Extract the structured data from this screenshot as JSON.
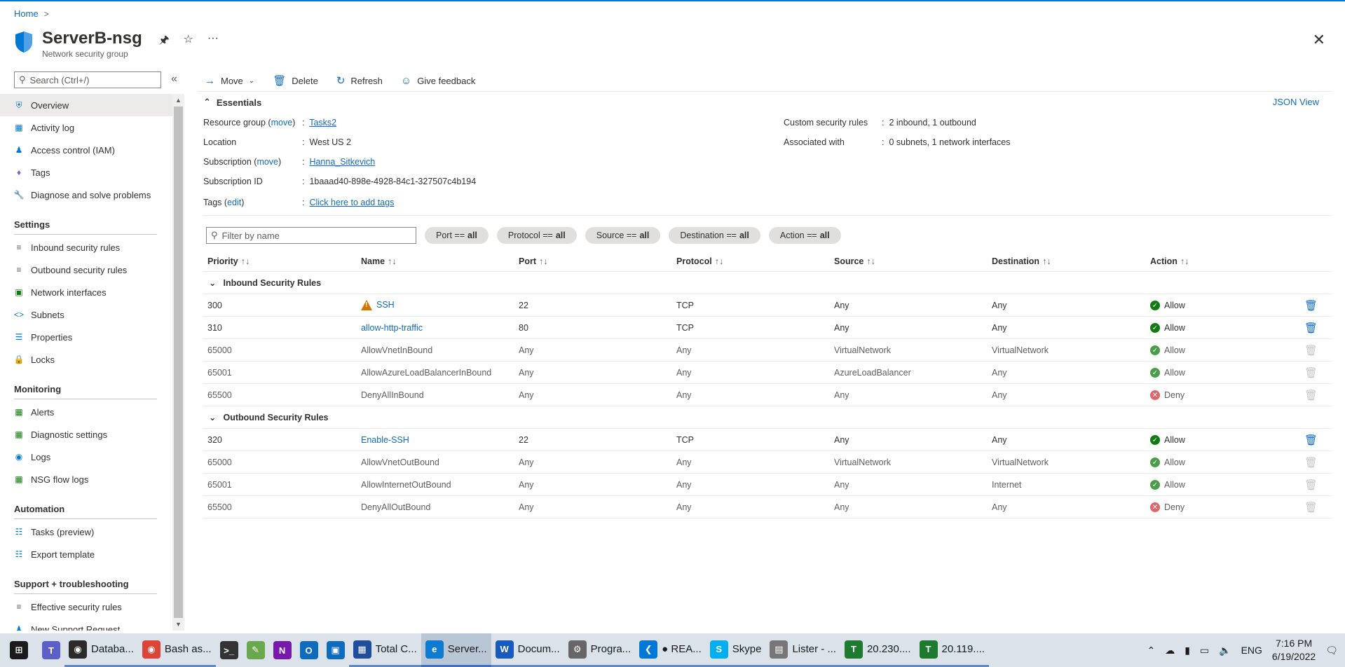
{
  "breadcrumb": {
    "home": "Home",
    "sep": ">"
  },
  "header": {
    "title": "ServerB-nsg",
    "subtitle": "Network security group"
  },
  "sidebar": {
    "search_placeholder": "Search (Ctrl+/)",
    "collapse": "«",
    "top_items": [
      "Overview",
      "Activity log",
      "Access control (IAM)",
      "Tags",
      "Diagnose and solve problems"
    ],
    "sections": [
      {
        "title": "Settings",
        "items": [
          "Inbound security rules",
          "Outbound security rules",
          "Network interfaces",
          "Subnets",
          "Properties",
          "Locks"
        ]
      },
      {
        "title": "Monitoring",
        "items": [
          "Alerts",
          "Diagnostic settings",
          "Logs",
          "NSG flow logs"
        ]
      },
      {
        "title": "Automation",
        "items": [
          "Tasks (preview)",
          "Export template"
        ]
      },
      {
        "title": "Support + troubleshooting",
        "items": [
          "Effective security rules",
          "New Support Request"
        ]
      }
    ]
  },
  "toolbar": {
    "move": "Move",
    "delete": "Delete",
    "refresh": "Refresh",
    "feedback": "Give feedback"
  },
  "essentials": {
    "title": "Essentials",
    "json_view": "JSON View",
    "resource_group_label": "Resource group",
    "move_link": "move",
    "resource_group_value": "Tasks2",
    "location_label": "Location",
    "location_value": "West US 2",
    "subscription_label": "Subscription",
    "subscription_value": "Hanna_Sitkevich",
    "subscription_id_label": "Subscription ID",
    "subscription_id_value": "1baaad40-898e-4928-84c1-327507c4b194",
    "tags_label": "Tags",
    "edit_link": "edit",
    "tags_value": "Click here to add tags",
    "custom_rules_label": "Custom security rules",
    "custom_rules_value": "2 inbound, 1 outbound",
    "associated_label": "Associated with",
    "associated_value": "0 subnets, 1 network interfaces",
    "colon": ":"
  },
  "filters": {
    "placeholder": "Filter by name",
    "pills": [
      {
        "label": "Port ==",
        "value": "all"
      },
      {
        "label": "Protocol ==",
        "value": "all"
      },
      {
        "label": "Source ==",
        "value": "all"
      },
      {
        "label": "Destination ==",
        "value": "all"
      },
      {
        "label": "Action ==",
        "value": "all"
      }
    ]
  },
  "table": {
    "columns": [
      "Priority",
      "Name",
      "Port",
      "Protocol",
      "Source",
      "Destination",
      "Action"
    ],
    "groups": [
      {
        "title": "Inbound Security Rules",
        "rows": [
          {
            "priority": "300",
            "name": "SSH",
            "port": "22",
            "protocol": "TCP",
            "source": "Any",
            "destination": "Any",
            "action": "Allow",
            "custom": true,
            "warning": true
          },
          {
            "priority": "310",
            "name": "allow-http-traffic",
            "port": "80",
            "protocol": "TCP",
            "source": "Any",
            "destination": "Any",
            "action": "Allow",
            "custom": true,
            "warning": false
          },
          {
            "priority": "65000",
            "name": "AllowVnetInBound",
            "port": "Any",
            "protocol": "Any",
            "source": "VirtualNetwork",
            "destination": "VirtualNetwork",
            "action": "Allow",
            "custom": false,
            "warning": false
          },
          {
            "priority": "65001",
            "name": "AllowAzureLoadBalancerInBound",
            "port": "Any",
            "protocol": "Any",
            "source": "AzureLoadBalancer",
            "destination": "Any",
            "action": "Allow",
            "custom": false,
            "warning": false
          },
          {
            "priority": "65500",
            "name": "DenyAllInBound",
            "port": "Any",
            "protocol": "Any",
            "source": "Any",
            "destination": "Any",
            "action": "Deny",
            "custom": false,
            "warning": false
          }
        ]
      },
      {
        "title": "Outbound Security Rules",
        "rows": [
          {
            "priority": "320",
            "name": "Enable-SSH",
            "port": "22",
            "protocol": "TCP",
            "source": "Any",
            "destination": "Any",
            "action": "Allow",
            "custom": true,
            "warning": false
          },
          {
            "priority": "65000",
            "name": "AllowVnetOutBound",
            "port": "Any",
            "protocol": "Any",
            "source": "VirtualNetwork",
            "destination": "VirtualNetwork",
            "action": "Allow",
            "custom": false,
            "warning": false
          },
          {
            "priority": "65001",
            "name": "AllowInternetOutBound",
            "port": "Any",
            "protocol": "Any",
            "source": "Any",
            "destination": "Internet",
            "action": "Allow",
            "custom": false,
            "warning": false
          },
          {
            "priority": "65500",
            "name": "DenyAllOutBound",
            "port": "Any",
            "protocol": "Any",
            "source": "Any",
            "destination": "Any",
            "action": "Deny",
            "custom": false,
            "warning": false
          }
        ]
      }
    ]
  },
  "taskbar": {
    "apps": [
      {
        "label": "",
        "icon": "windows-start-icon",
        "color": "#1b1b1b"
      },
      {
        "label": "",
        "icon": "teams-icon",
        "color": "#5b5fc7"
      },
      {
        "label": "Databa...",
        "icon": "database-app-icon",
        "color": "#2b2b2b"
      },
      {
        "label": "Bash as...",
        "icon": "chrome-icon",
        "color": "#db4437"
      },
      {
        "label": "",
        "icon": "terminal-icon",
        "color": "#333333"
      },
      {
        "label": "",
        "icon": "notepad-icon",
        "color": "#6aa84f"
      },
      {
        "label": "",
        "icon": "onenote-icon",
        "color": "#7719aa"
      },
      {
        "label": "",
        "icon": "outlook-icon",
        "color": "#0f6cbd"
      },
      {
        "label": "",
        "icon": "remote-desktop-icon",
        "color": "#0f6cbd"
      },
      {
        "label": "Total C...",
        "icon": "total-commander-icon",
        "color": "#1f4e9c"
      },
      {
        "label": "Server...",
        "icon": "edge-icon",
        "color": "#0c7bd1"
      },
      {
        "label": "Docum...",
        "icon": "word-icon",
        "color": "#185abd"
      },
      {
        "label": "Progra...",
        "icon": "program-icon",
        "color": "#666666"
      },
      {
        "label": "● REA...",
        "icon": "vscode-icon",
        "color": "#0078d4"
      },
      {
        "label": "Skype",
        "icon": "skype-icon",
        "color": "#00aff0"
      },
      {
        "label": "Lister - ...",
        "icon": "lister-icon",
        "color": "#777777"
      },
      {
        "label": "20.230....",
        "icon": "terminal-t-icon",
        "color": "#1e7a2e"
      },
      {
        "label": "20.119....",
        "icon": "terminal-t-icon",
        "color": "#1e7a2e"
      }
    ],
    "lang": "ENG",
    "time": "7:16 PM",
    "date": "6/19/2022"
  }
}
